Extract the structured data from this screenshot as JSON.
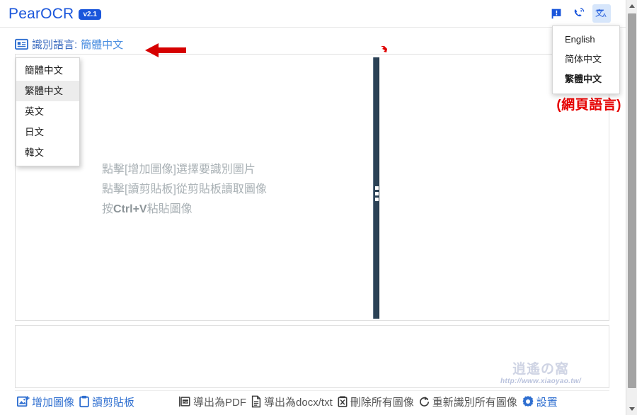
{
  "app": {
    "brand_name": "PearOCR",
    "version_badge": "v2.1"
  },
  "header": {
    "icons": [
      {
        "name": "feedback-flag-icon",
        "glyph": "flag"
      },
      {
        "name": "contact-phone-icon",
        "glyph": "phone"
      },
      {
        "name": "translate-language-icon",
        "glyph": "translate"
      }
    ]
  },
  "web_language_menu": {
    "open": true,
    "items": [
      {
        "label": "English",
        "selected": false
      },
      {
        "label": "简体中文",
        "selected": false
      },
      {
        "label": "繁體中文",
        "selected": true
      }
    ]
  },
  "recognition_language": {
    "icon": "language-card-icon",
    "label": "識別語言:",
    "value": "簡體中文",
    "menu_open": true,
    "menu_items": [
      {
        "label": "簡體中文",
        "highlighted": false
      },
      {
        "label": "繁體中文",
        "highlighted": true
      },
      {
        "label": "英文",
        "highlighted": false
      },
      {
        "label": "日文",
        "highlighted": false
      },
      {
        "label": "韓文",
        "highlighted": false
      }
    ]
  },
  "annotations": {
    "arrow_color": "#d60000",
    "web_language_note": "(網頁語言)"
  },
  "work_panel": {
    "placeholder_lines": [
      "點擊[增加圖像]選擇要識別圖片",
      "點擊[讀剪貼板]從剪貼板讀取圖像"
    ],
    "placeholder_shortcut_prefix": "按",
    "placeholder_shortcut_key": "Ctrl+V",
    "placeholder_shortcut_suffix": "粘貼圖像",
    "splitter_color": "#2b4256"
  },
  "result_panel": {
    "watermark_logo": "逍遙の窩",
    "watermark_url": "http://www.xiaoyao.tw/"
  },
  "toolbar": {
    "left_buttons": [
      {
        "label": "增加圖像",
        "icon": "add-image-icon",
        "tone": "blue"
      },
      {
        "label": "讀剪貼板",
        "icon": "clipboard-icon",
        "tone": "blue"
      }
    ],
    "right_buttons": [
      {
        "label": "導出為PDF",
        "icon": "pdf-icon",
        "tone": "gray"
      },
      {
        "label": "導出為docx/txt",
        "icon": "document-icon",
        "tone": "gray"
      },
      {
        "label": "刪除所有圖像",
        "icon": "trash-icon",
        "tone": "gray"
      },
      {
        "label": "重新識別所有圖像",
        "icon": "refresh-icon",
        "tone": "gray"
      },
      {
        "label": "設置",
        "icon": "gear-icon",
        "tone": "blue"
      }
    ]
  },
  "colors": {
    "brand_blue": "#1a56db",
    "link_blue": "#2f6fd0",
    "accent_red": "#e50000",
    "splitter_navy": "#2b4256"
  }
}
